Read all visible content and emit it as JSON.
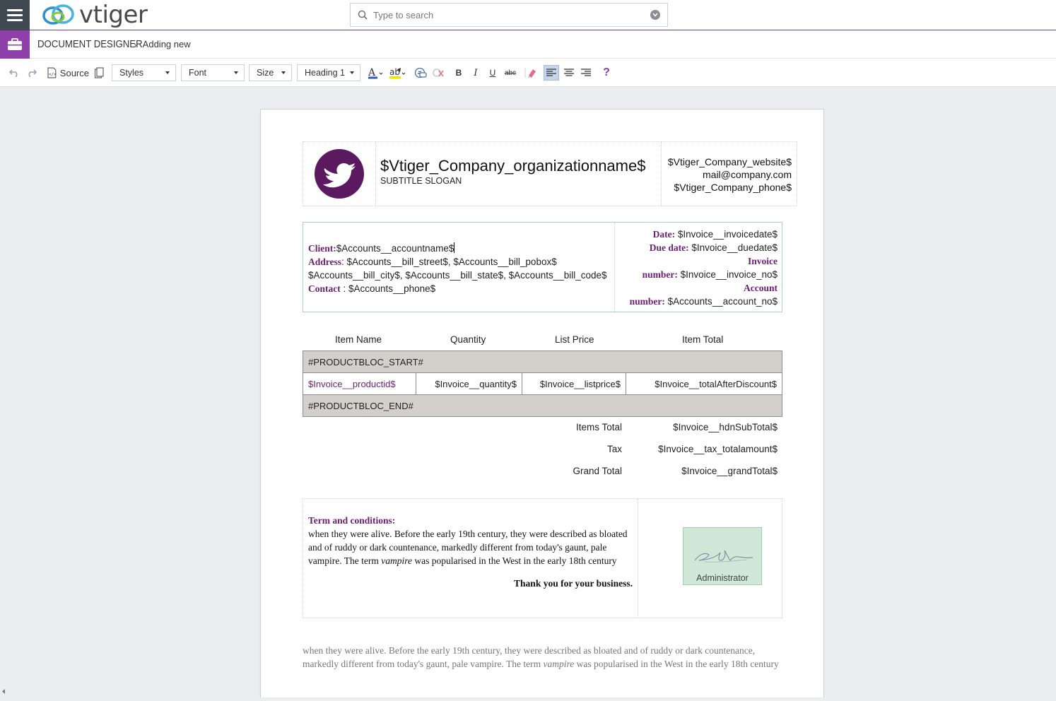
{
  "app": {
    "logo_text": "vtiger"
  },
  "search": {
    "placeholder": "Type to search"
  },
  "breadcrumb": {
    "module": "DOCUMENT DESIGNER",
    "current": "Adding new"
  },
  "toolbar": {
    "source_label": "Source",
    "styles_label": "Styles",
    "font_label": "Font",
    "size_label": "Size",
    "format_label": "Heading 1"
  },
  "header": {
    "org_name": "$Vtiger_Company_organizationname$",
    "slogan": "SUBTITLE SLOGAN",
    "website": "$Vtiger_Company_website$",
    "email": "mail@company.com",
    "phone": "$Vtiger_Company_phone$"
  },
  "client": {
    "client_label": "Client:",
    "client_value": "$Accounts__accountname$",
    "address_label": "Address",
    "address_line1": ": $Accounts__bill_street$, $Accounts__bill_pobox$",
    "address_line2": "$Accounts__bill_city$, $Accounts__bill_state$, $Accounts__bill_code$",
    "contact_label": "Contact",
    "contact_value": ": $Accounts__phone$",
    "date_label": "Date:",
    "date_value": "$Invoice__invoicedate$",
    "due_label": "Due date:",
    "due_value": "$Invoice__duedate$",
    "invoice_label_1": "Invoice",
    "invoice_label_2": "number:",
    "invoice_value": "$Invoice__invoice_no$",
    "account_label_1": "Account",
    "account_label_2": "number:",
    "account_value": "$Accounts__account_no$"
  },
  "items": {
    "columns": [
      "Item Name",
      "Quantity",
      "List Price",
      "Item Total"
    ],
    "block_start": "#PRODUCTBLOC_START#",
    "block_end": "#PRODUCTBLOC_END#",
    "row": {
      "product": "$Invoice__productid$",
      "quantity": "$Invoice__quantity$",
      "listprice": "$Invoice__listprice$",
      "total": "$Invoice__totalAfterDiscount$"
    }
  },
  "totals": [
    {
      "label": "Items Total",
      "value": "$Invoice__hdnSubTotal$"
    },
    {
      "label": "Tax",
      "value": "$Invoice__tax_totalamount$"
    },
    {
      "label": "Grand Total",
      "value": "$Invoice__grandTotal$"
    }
  ],
  "terms": {
    "title": "Term and conditions:",
    "text_before": "when they were alive. Before the early 19th century, they were described as bloated and of ruddy or dark countenance, markedly different from today's gaunt, pale vampire. The term ",
    "text_italic": "vampire",
    "text_after": " was popularised in the West in the early 18th century",
    "thanks": "Thank you for your business.",
    "signature_name": "Administrator"
  },
  "footnote": {
    "text_before": " when they were alive. Before the early 19th century, they were described as bloated and of ruddy or dark countenance, markedly different from today's gaunt, pale vampire. The term ",
    "text_italic": "vampire",
    "text_after": " was popularised in the West in the early 18th century"
  },
  "colors": {
    "brand_purple": "#8e3fa8",
    "label_purple": "#6b1f73",
    "sidebar_dark": "#404952"
  }
}
